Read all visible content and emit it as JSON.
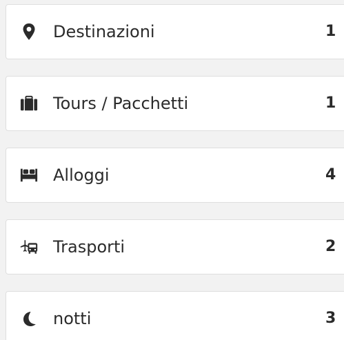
{
  "items": [
    {
      "label": "Destinazioni",
      "count": "1",
      "icon": "map-marker-icon"
    },
    {
      "label": "Tours / Pacchetti",
      "count": "1",
      "icon": "suitcase-icon"
    },
    {
      "label": "Alloggi",
      "count": "4",
      "icon": "bed-icon"
    },
    {
      "label": "Trasporti",
      "count": "2",
      "icon": "plane-bus-icon"
    },
    {
      "label": "notti",
      "count": "3",
      "icon": "moon-icon"
    }
  ],
  "colors": {
    "background": "#f2f2f2",
    "card": "#ffffff",
    "border": "#dedede",
    "text": "#2b2b2b"
  }
}
